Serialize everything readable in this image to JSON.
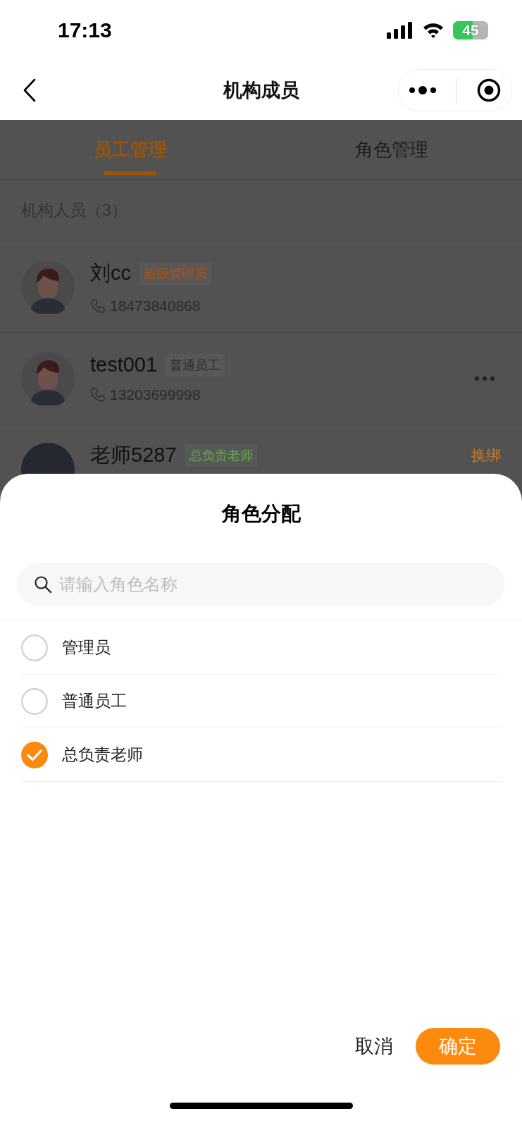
{
  "status_bar": {
    "time": "17:13",
    "battery": "45"
  },
  "nav": {
    "title": "机构成员"
  },
  "tabs": [
    {
      "label": "员工管理",
      "selected": true
    },
    {
      "label": "角色管理",
      "selected": false
    }
  ],
  "section_header": "机构人员（3）",
  "members": [
    {
      "name": "刘cc",
      "kind": "silhouette",
      "role": {
        "label": "超级管理员",
        "color": "#b4520f"
      },
      "phone": "18473840868",
      "more": false
    },
    {
      "name": "test001",
      "kind": "silhouette",
      "role": {
        "label": "普通员工",
        "color": "#2a2a2a"
      },
      "phone": "13203699998",
      "more": true
    },
    {
      "name": "老师5287",
      "kind": "dark",
      "role": {
        "label": "总负责老师",
        "color": "#62b049"
      },
      "action": "换绑",
      "more": false
    }
  ],
  "dialog": {
    "title": "角色分配",
    "search": {
      "placeholder": "请输入角色名称"
    },
    "options": [
      {
        "label": "管理员",
        "selected": false
      },
      {
        "label": "普通员工",
        "selected": false
      },
      {
        "label": "总负责老师",
        "selected": true
      }
    ],
    "cancel": "取消",
    "confirm": "确定"
  }
}
